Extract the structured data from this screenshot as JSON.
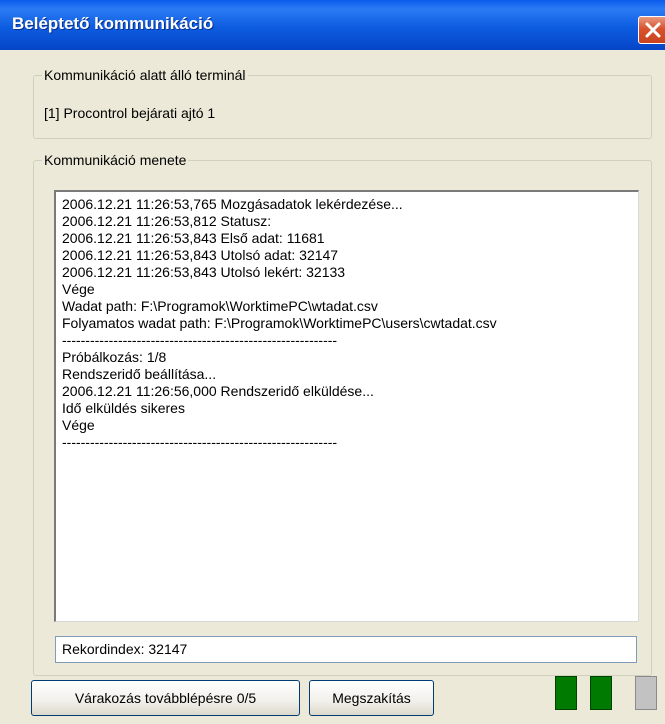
{
  "window": {
    "title": "Beléptető kommunikáció"
  },
  "terminal_group": {
    "legend": "Kommunikáció alatt álló terminál",
    "terminal": "[1]  Procontrol bejárati ajtó  1"
  },
  "log_group": {
    "legend": "Kommunikáció menete",
    "lines": [
      "2006.12.21 11:26:53,765 Mozgásadatok lekérdezése...",
      "2006.12.21 11:26:53,812 Statusz:",
      "2006.12.21 11:26:53,843 Első adat: 11681",
      "2006.12.21 11:26:53,843 Utolsó adat: 32147",
      "2006.12.21 11:26:53,843 Utolsó lekért: 32133",
      "Vége",
      "Wadat path: F:\\Programok\\WorktimePC\\wtadat.csv",
      "Folyamatos wadat path: F:\\Programok\\WorktimePC\\users\\cwtadat.csv",
      "-----------------------------------------------------------",
      "Próbálkozás: 1/8",
      "Rendszeridő beállítása...",
      "2006.12.21 11:26:56,000 Rendszeridő elküldése...",
      "Idő elküldés sikeres",
      "Vége",
      "-----------------------------------------------------------"
    ]
  },
  "record_field": {
    "value": "Rekordindex: 32147"
  },
  "buttons": {
    "wait": "Várakozás továbblépésre 0/5",
    "abort": "Megszakítás"
  },
  "indicators": [
    {
      "name": "indicator-1",
      "color": "#007A00"
    },
    {
      "name": "indicator-2",
      "color": "#007A00"
    },
    {
      "name": "indicator-3",
      "color": "#C2C2C2"
    }
  ],
  "icons": {
    "close": "close-icon"
  }
}
